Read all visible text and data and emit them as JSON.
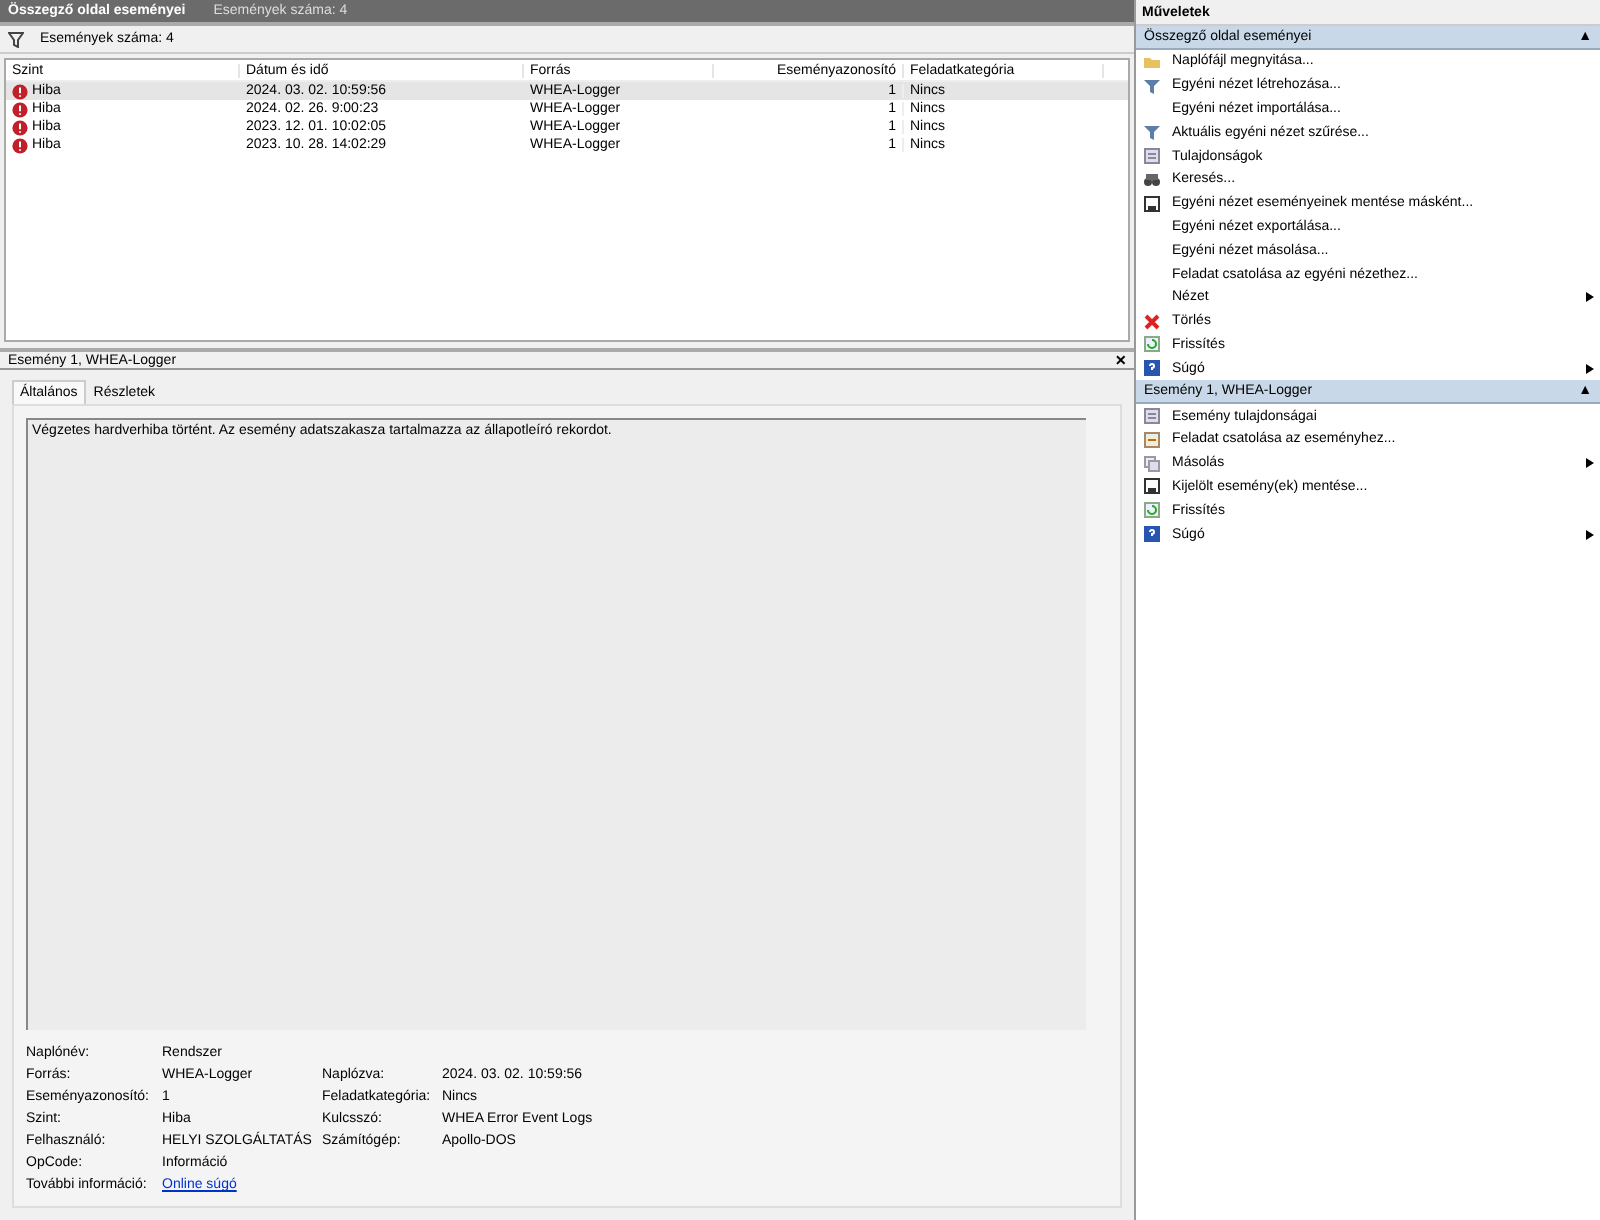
{
  "header": {
    "title": "Összegző oldal eseményei",
    "count": "Események száma: 4"
  },
  "filter_bar": {
    "text": "Események száma: 4"
  },
  "table": {
    "columns": [
      "Szint",
      "Dátum és idő",
      "Forrás",
      "Eseményazonosító",
      "Feladatkategória"
    ],
    "rows": [
      {
        "selected": true,
        "cells": [
          "Hiba",
          "2024. 03. 02. 10:59:56",
          "WHEA-Logger",
          "1",
          "Nincs"
        ]
      },
      {
        "selected": false,
        "cells": [
          "Hiba",
          "2024. 02. 26. 9:00:23",
          "WHEA-Logger",
          "1",
          "Nincs"
        ]
      },
      {
        "selected": false,
        "cells": [
          "Hiba",
          "2023. 12. 01. 10:02:05",
          "WHEA-Logger",
          "1",
          "Nincs"
        ]
      },
      {
        "selected": false,
        "cells": [
          "Hiba",
          "2023. 10. 28. 14:02:29",
          "WHEA-Logger",
          "1",
          "Nincs"
        ]
      }
    ]
  },
  "detail": {
    "title": "Esemény 1, WHEA-Logger",
    "close": "×",
    "tabs": [
      {
        "label": "Általános",
        "selected": true
      },
      {
        "label": "Részletek",
        "selected": false
      }
    ],
    "message": "Végzetes hardverhiba történt. Az esemény adatszakasza tartalmazza az állapotleíró rekordot.",
    "fields": [
      {
        "label": "Naplónév:",
        "value": "Rendszer"
      },
      {
        "label": "Forrás:",
        "value": "WHEA-Logger",
        "label2": "Naplózva:",
        "value2": "2024. 03. 02. 10:59:56"
      },
      {
        "label": "Eseményazonosító:",
        "value": "1",
        "label2": "Feladatkategória:",
        "value2": "Nincs"
      },
      {
        "label": "Szint:",
        "value": "Hiba",
        "label2": "Kulcsszó:",
        "value2": "WHEA Error Event Logs"
      },
      {
        "label": "Felhasználó:",
        "value": "HELYI SZOLGÁLTATÁS",
        "label2": "Számítógép:",
        "value2": "Apollo-DOS"
      },
      {
        "label": "OpCode:",
        "value": "Információ"
      },
      {
        "label": "További információ:",
        "link": "Online súgó"
      }
    ]
  },
  "actions": {
    "title": "Műveletek",
    "sections": [
      {
        "title": "Összegző oldal eseményei",
        "collapse": "▲",
        "items": [
          {
            "kind": "folder",
            "label": "Naplófájl megnyitása...",
            "submenu": false
          },
          {
            "kind": "filter",
            "label": "Egyéni nézet létrehozása...",
            "submenu": false
          },
          {
            "kind": "none",
            "label": "Egyéni nézet importálása...",
            "submenu": false
          },
          {
            "kind": "filter",
            "label": "Aktuális egyéni nézet szűrése...",
            "submenu": false
          },
          {
            "kind": "properties",
            "label": "Tulajdonságok",
            "submenu": false
          },
          {
            "kind": "binoculars",
            "label": "Keresés...",
            "submenu": false
          },
          {
            "kind": "save",
            "label": "Egyéni nézet eseményeinek mentése másként...",
            "submenu": false
          },
          {
            "kind": "none",
            "label": "Egyéni nézet exportálása...",
            "submenu": false
          },
          {
            "kind": "none",
            "label": "Egyéni nézet másolása...",
            "submenu": false
          },
          {
            "kind": "none",
            "label": "Feladat csatolása az egyéni nézethez...",
            "submenu": false
          },
          {
            "kind": "none",
            "label": "Nézet",
            "submenu": true
          },
          {
            "kind": "delete",
            "label": "Törlés",
            "submenu": false
          },
          {
            "kind": "refresh",
            "label": "Frissítés",
            "submenu": false
          },
          {
            "kind": "help",
            "label": "Súgó",
            "submenu": true
          }
        ]
      },
      {
        "title": "Esemény 1, WHEA-Logger",
        "collapse": "▲",
        "items": [
          {
            "kind": "properties",
            "label": "Esemény tulajdonságai",
            "submenu": false
          },
          {
            "kind": "task",
            "label": "Feladat csatolása az eseményhez...",
            "submenu": false
          },
          {
            "kind": "copy",
            "label": "Másolás",
            "submenu": true
          },
          {
            "kind": "save",
            "label": "Kijelölt esemény(ek) mentése...",
            "submenu": false
          },
          {
            "kind": "refresh",
            "label": "Frissítés",
            "submenu": false
          },
          {
            "kind": "help",
            "label": "Súgó",
            "submenu": true
          }
        ]
      }
    ]
  }
}
